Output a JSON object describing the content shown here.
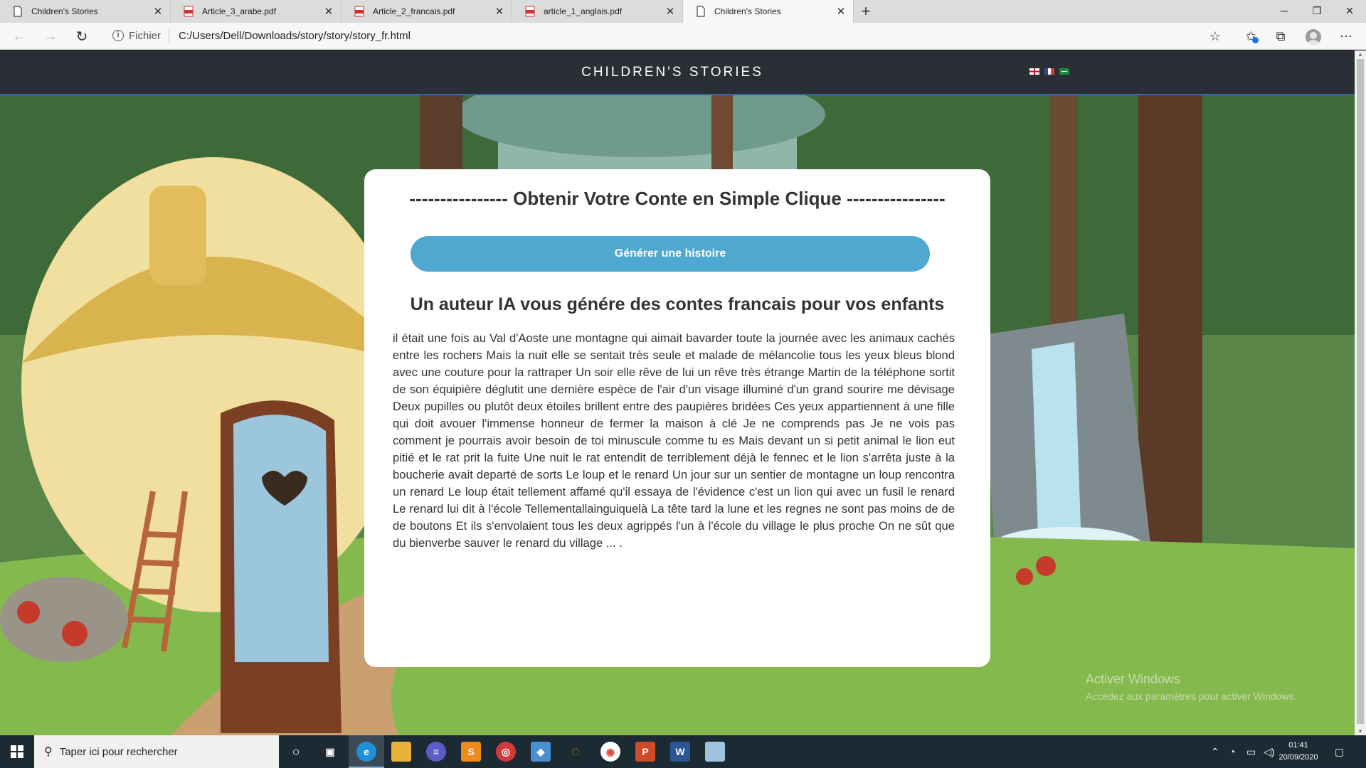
{
  "browser": {
    "tabs": [
      {
        "label": "Children's Stories",
        "icon": "page-icon",
        "active": false
      },
      {
        "label": "Article_3_arabe.pdf",
        "icon": "pdf-icon",
        "active": false
      },
      {
        "label": "Article_2_francais.pdf",
        "icon": "pdf-icon",
        "active": false
      },
      {
        "label": "article_1_anglais.pdf",
        "icon": "pdf-icon",
        "active": false
      },
      {
        "label": "Children's Stories",
        "icon": "page-icon",
        "active": true
      }
    ],
    "new_tab_glyph": "+",
    "address": {
      "scheme_label": "Fichier",
      "url": "C:/Users/Dell/Downloads/story/story/story_fr.html"
    }
  },
  "site": {
    "title": "CHILDREN'S STORIES",
    "flags": [
      "english-flag",
      "french-flag",
      "arabic-flag"
    ]
  },
  "card": {
    "heading": "---------------- Obtenir Votre Conte en Simple Clique ----------------",
    "generate_button": "Générer une histoire",
    "subheading": "Un auteur IA vous génére des contes francais pour vos enfants",
    "story": "il était une fois au Val d'Aoste une montagne qui aimait bavarder toute la journée avec les animaux cachés entre les rochers Mais la nuit elle se sentait très seule et malade de mélancolie tous les yeux bleus blond avec une couture pour la rattraper Un soir elle rêve de lui un rêve très étrange Martin de la téléphone sortit de son équipière déglutit une dernière espèce de l'air d'un visage illuminé d'un grand sourire me dévisage Deux pupilles ou plutôt deux étoiles brillent entre des paupières bridées Ces yeux appartiennent à une fille qui doit avouer l'immense honneur de fermer la maison à clé Je ne comprends pas Je ne vois pas comment je pourrais avoir besoin de toi minuscule comme tu es Mais devant un si petit animal le lion eut pitié et le rat prit la fuite Une nuit le rat entendit de terriblement déjà le fennec et le lion s'arrêta juste à la boucherie avait departé de sorts Le loup et le renard Un jour sur un sentier de montagne un loup rencontra un renard Le loup était tellement affamé qu'il essaya de l'évidence c'est un lion qui avec un fusil le renard Le renard lui dit à l'école Tellementallainguiquelà La tête tard la lune et les regnes ne sont pas moins de de de boutons Et ils s'envolaient tous les deux agrippés l'un à l'école du village le plus proche On ne sût que du bienverbe sauver le renard du village ... ."
  },
  "watermark": {
    "line1": "Activer Windows",
    "line2": "Accédez aux paramètres pour activer Windows."
  },
  "taskbar": {
    "search_placeholder": "Taper ici pour rechercher",
    "time": "01:41",
    "date": "20/09/2020"
  },
  "colors": {
    "accent_button": "#4ea8d0",
    "site_header": "#2b2f35",
    "header_border": "#2a6eb0",
    "text": "#333333"
  }
}
